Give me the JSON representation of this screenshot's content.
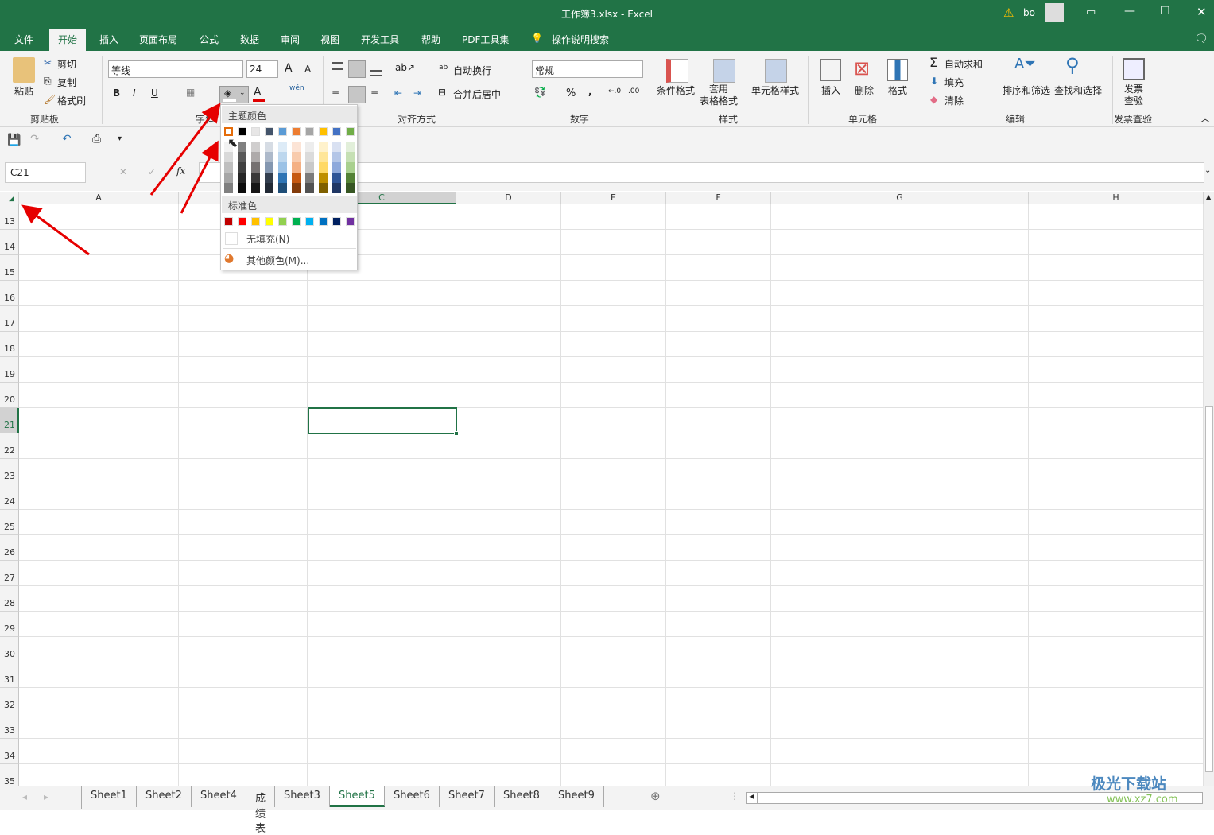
{
  "titlebar": {
    "title": "工作簿3.xlsx  -  Excel",
    "user": "bo",
    "warning_icon": "warning-icon",
    "buttons": [
      "ribbon-display-icon",
      "minimize-icon",
      "maximize-icon",
      "close-icon"
    ]
  },
  "menu": {
    "items": [
      "文件",
      "开始",
      "插入",
      "页面布局",
      "公式",
      "数据",
      "审阅",
      "视图",
      "开发工具",
      "帮助",
      "PDF工具集"
    ],
    "active": "开始",
    "search": "操作说明搜索"
  },
  "ribbon": {
    "clipboard": {
      "paste": "粘贴",
      "cut": "剪切",
      "copy": "复制",
      "format_painter": "格式刷",
      "label": "剪贴板"
    },
    "font": {
      "name": "等线",
      "size": "24",
      "bold": "B",
      "italic": "I",
      "underline": "U",
      "phonetic": "wén",
      "label": "字体",
      "font_color": "#e00000"
    },
    "alignment": {
      "wrap": "自动换行",
      "merge": "合并后居中",
      "label": "对齐方式"
    },
    "number": {
      "format": "常规",
      "percent": "%",
      "comma": ",",
      "label": "数字"
    },
    "styles": {
      "conditional": "条件格式",
      "table": "套用\n表格格式",
      "cell_styles": "单元格样式",
      "label": "样式"
    },
    "cells": {
      "insert": "插入",
      "delete": "删除",
      "format": "格式",
      "label": "单元格"
    },
    "editing": {
      "autosum": "自动求和",
      "fill": "填充",
      "clear": "清除",
      "sort": "排序和筛选",
      "find": "查找和选择",
      "label": "编辑"
    },
    "invoice": {
      "check": "发票\n查验",
      "label": "发票查验"
    }
  },
  "formula_bar": {
    "name_box": "C21",
    "fx": "fx",
    "value": ""
  },
  "columns": [
    "A",
    "B",
    "C",
    "D",
    "E",
    "F",
    "G",
    "H"
  ],
  "selected_column": "C",
  "rows": [
    13,
    14,
    15,
    16,
    17,
    18,
    19,
    20,
    21,
    22,
    23,
    24,
    25,
    26,
    27,
    28,
    29,
    30,
    31,
    32,
    33,
    34,
    35
  ],
  "selected_row": 21,
  "sheet_tabs": [
    "Sheet1",
    "Sheet2",
    "Sheet4",
    "成绩表",
    "Sheet3",
    "Sheet5",
    "Sheet6",
    "Sheet7",
    "Sheet8",
    "Sheet9"
  ],
  "active_sheet": "Sheet5",
  "fill_dropdown": {
    "theme_label": "主题颜色",
    "theme_colors": [
      "#ffffff",
      "#000000",
      "#e7e6e6",
      "#44546a",
      "#5b9bd5",
      "#ed7d31",
      "#a5a5a5",
      "#ffc000",
      "#4472c4",
      "#70ad47"
    ],
    "theme_shades": [
      [
        "#f2f2f2",
        "#d9d9d9",
        "#bfbfbf",
        "#a6a6a6",
        "#808080"
      ],
      [
        "#808080",
        "#595959",
        "#404040",
        "#262626",
        "#0d0d0d"
      ],
      [
        "#d0cece",
        "#aeaaaa",
        "#767171",
        "#3a3838",
        "#171616"
      ],
      [
        "#d6dce4",
        "#adb9ca",
        "#8497b0",
        "#333f4f",
        "#222a35"
      ],
      [
        "#ddebf7",
        "#bdd7ee",
        "#9bc2e6",
        "#2f75b5",
        "#1f4e78"
      ],
      [
        "#fce4d6",
        "#f8cbad",
        "#f4b084",
        "#c65911",
        "#833c0b"
      ],
      [
        "#ededed",
        "#dbdbdb",
        "#c9c9c9",
        "#7b7b7b",
        "#525252"
      ],
      [
        "#fff2cc",
        "#ffe699",
        "#ffd966",
        "#bf8f00",
        "#7f6000"
      ],
      [
        "#d9e1f2",
        "#b4c6e7",
        "#8ea9db",
        "#2f5597",
        "#203764"
      ],
      [
        "#e2efda",
        "#c6e0b4",
        "#a9d08e",
        "#548235",
        "#375623"
      ]
    ],
    "standard_label": "标准色",
    "standard_colors": [
      "#c00000",
      "#ff0000",
      "#ffc000",
      "#ffff00",
      "#92d050",
      "#00b050",
      "#00b0f0",
      "#0070c0",
      "#002060",
      "#7030a0"
    ],
    "no_fill": "无填充(N)",
    "more_colors": "其他颜色(M)..."
  },
  "watermark": {
    "text": "极光下载站",
    "url": "www.xz7.com"
  }
}
